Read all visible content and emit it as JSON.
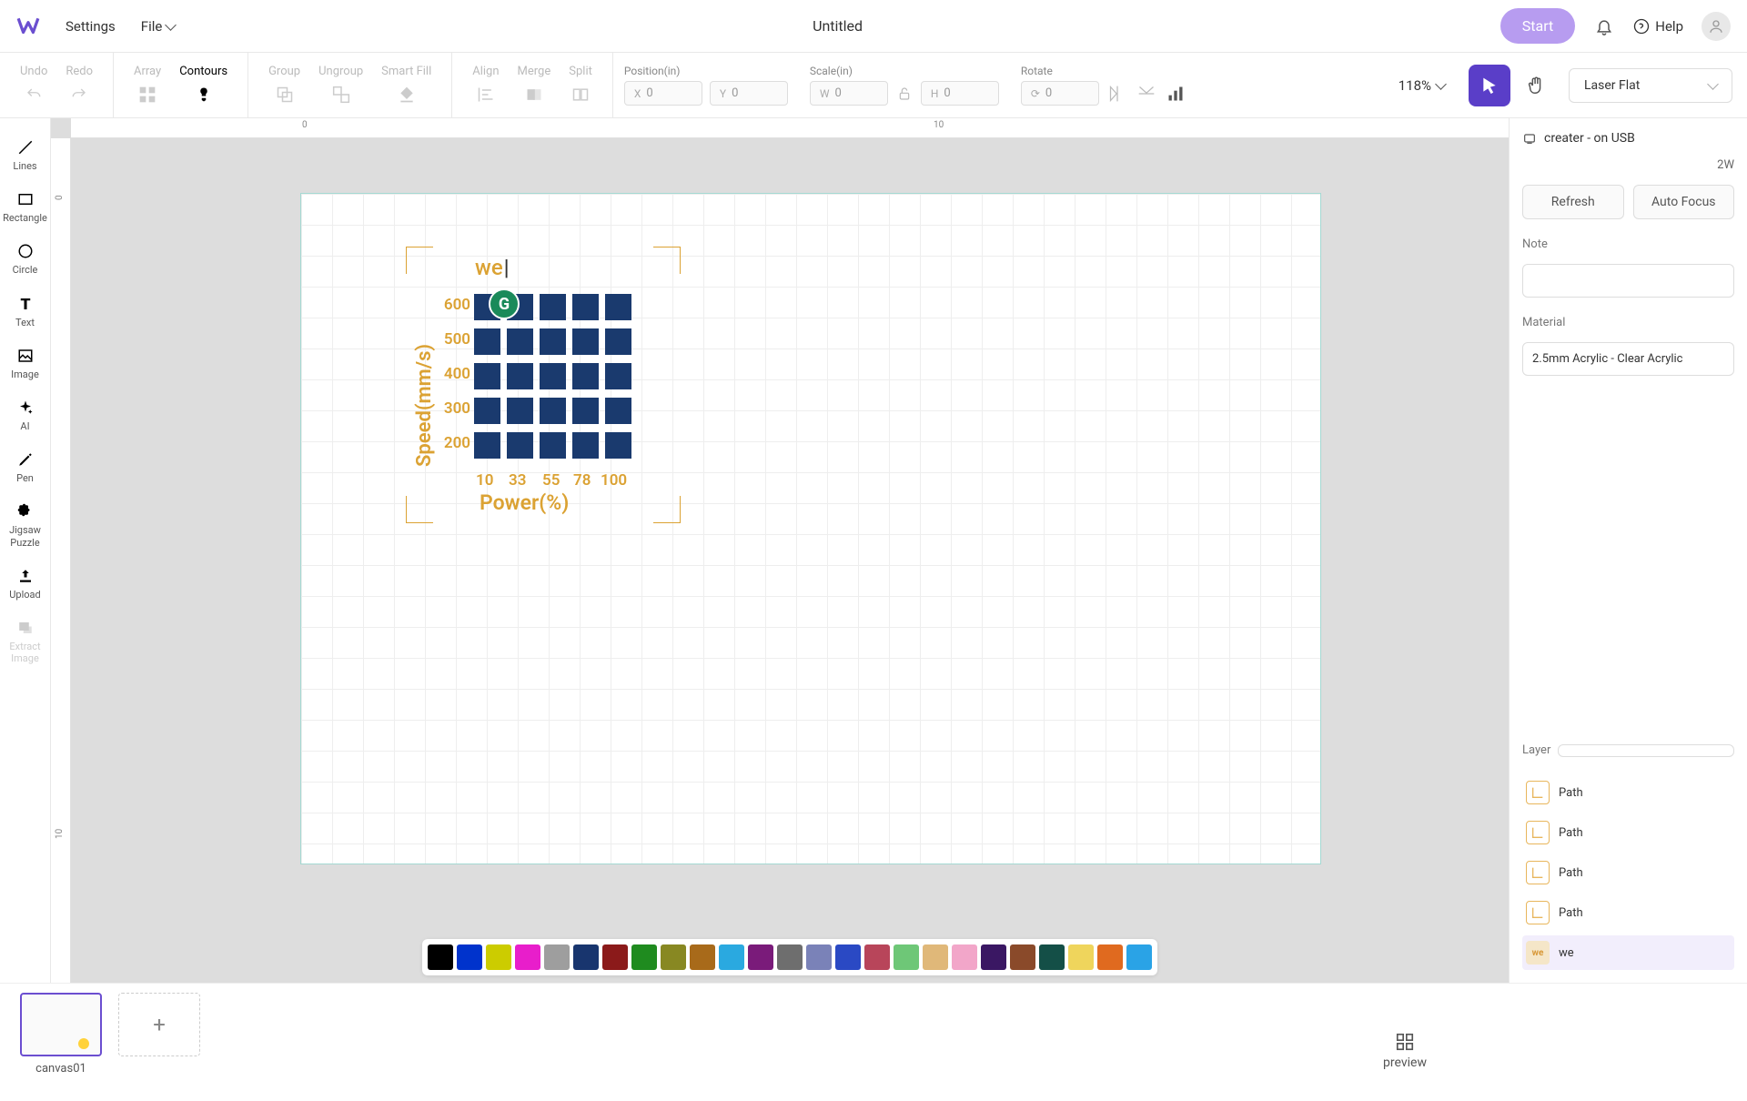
{
  "header": {
    "settings": "Settings",
    "file": "File",
    "title": "Untitled",
    "start": "Start",
    "help": "Help"
  },
  "toolbar": {
    "undo": "Undo",
    "redo": "Redo",
    "array": "Array",
    "contours": "Contours",
    "group": "Group",
    "ungroup": "Ungroup",
    "smartfill": "Smart Fill",
    "align": "Align",
    "merge": "Merge",
    "split": "Split",
    "position_lbl": "Position(in)",
    "scale_lbl": "Scale(in)",
    "rotate_lbl": "Rotate",
    "x": "0",
    "y": "0",
    "w": "0",
    "h": "0",
    "rot": "0",
    "zoom": "118%",
    "mode": "Laser Flat"
  },
  "sidetools": {
    "lines": "Lines",
    "rectangle": "Rectangle",
    "circle": "Circle",
    "text": "Text",
    "image": "Image",
    "ai": "AI",
    "pen": "Pen",
    "jigsaw": "Jigsaw\nPuzzle",
    "upload": "Upload",
    "extract": "Extract\nImage"
  },
  "ruler": {
    "h0": "0",
    "h10": "10",
    "v0": "0",
    "v10": "10"
  },
  "chart_data": {
    "type": "heatmap",
    "title": "we",
    "xlabel": "Power(%)",
    "ylabel": "Speed(mm/s)",
    "x_ticks": [
      "10",
      "33",
      "55",
      "78",
      "100"
    ],
    "y_ticks": [
      "600",
      "500",
      "400",
      "300",
      "200"
    ],
    "rows": 5,
    "cols": 5,
    "cell_color": "#1a3a6e",
    "label_color": "#dba233"
  },
  "palette": [
    "#000000",
    "#0033cc",
    "#cccc00",
    "#e81ecb",
    "#9e9e9e",
    "#18356e",
    "#8b1a1a",
    "#1f8b1f",
    "#888822",
    "#a86a1a",
    "#2aa9e0",
    "#7a1b7a",
    "#6e6e6e",
    "#7a82b8",
    "#2a49c4",
    "#b8455a",
    "#6ec777",
    "#e0b879",
    "#f2a6c9",
    "#3a1763",
    "#8a4a2a",
    "#144f47",
    "#efd55c",
    "#e06a1f",
    "#2aa3e6"
  ],
  "footer": {
    "canvas_name": "canvas01",
    "preview": "preview"
  },
  "rpanel": {
    "device": "creater - on USB",
    "watt": "2W",
    "refresh": "Refresh",
    "autofocus": "Auto Focus",
    "note_lbl": "Note",
    "material_lbl": "Material",
    "material_val": "2.5mm Acrylic - Clear Acrylic",
    "layer_lbl": "Layer",
    "layers": [
      {
        "type": "path",
        "name": "Path"
      },
      {
        "type": "path",
        "name": "Path"
      },
      {
        "type": "path",
        "name": "Path"
      },
      {
        "type": "path",
        "name": "Path"
      },
      {
        "type": "text",
        "name": "we"
      }
    ]
  }
}
